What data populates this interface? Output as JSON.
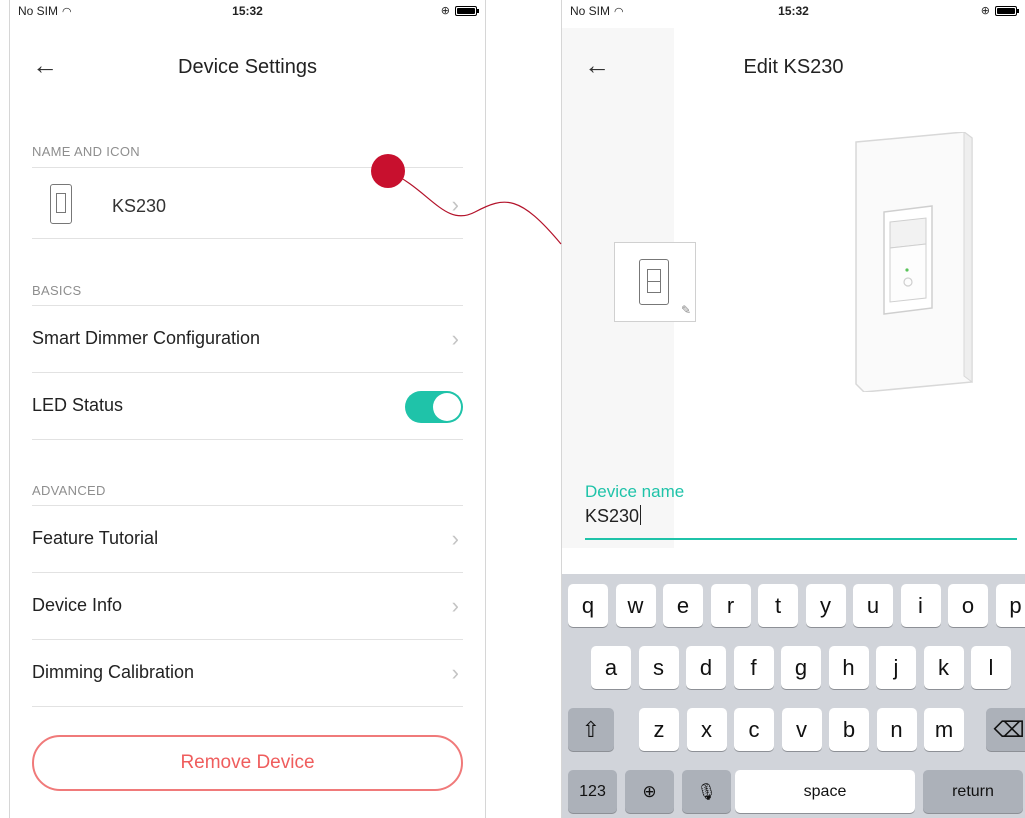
{
  "left": {
    "status": {
      "carrier": "No SIM",
      "time": "15:32"
    },
    "nav": {
      "back": "←",
      "title": "Device Settings"
    },
    "sections": {
      "name_icon": "NAME AND ICON",
      "basics": "BASICS",
      "advanced": "ADVANCED"
    },
    "device_name": "KS230",
    "rows": {
      "smart_dimmer": "Smart Dimmer Configuration",
      "led_status": "LED Status",
      "feature_tutorial": "Feature Tutorial",
      "device_info": "Device Info",
      "dimming_calibration": "Dimming Calibration"
    },
    "led_status_on": true,
    "chevron": "›",
    "remove_button": "Remove Device"
  },
  "right": {
    "status": {
      "carrier": "No SIM",
      "time": "15:32"
    },
    "nav": {
      "back": "←",
      "title": "Edit KS230"
    },
    "field": {
      "label": "Device name",
      "value": "KS230"
    },
    "keyboard": {
      "row1": [
        "q",
        "w",
        "e",
        "r",
        "t",
        "y",
        "u",
        "i",
        "o",
        "p"
      ],
      "row2": [
        "a",
        "s",
        "d",
        "f",
        "g",
        "h",
        "j",
        "k",
        "l"
      ],
      "row3": [
        "z",
        "x",
        "c",
        "v",
        "b",
        "n",
        "m"
      ],
      "shift": "⇧",
      "delete": "⌫",
      "numbers": "123",
      "globe": "🌐",
      "mic": "🎙",
      "space": "space",
      "return": "return"
    }
  },
  "colors": {
    "accent": "#1fc3a9",
    "danger": "#ef5d5d",
    "pin": "#c8102e"
  }
}
